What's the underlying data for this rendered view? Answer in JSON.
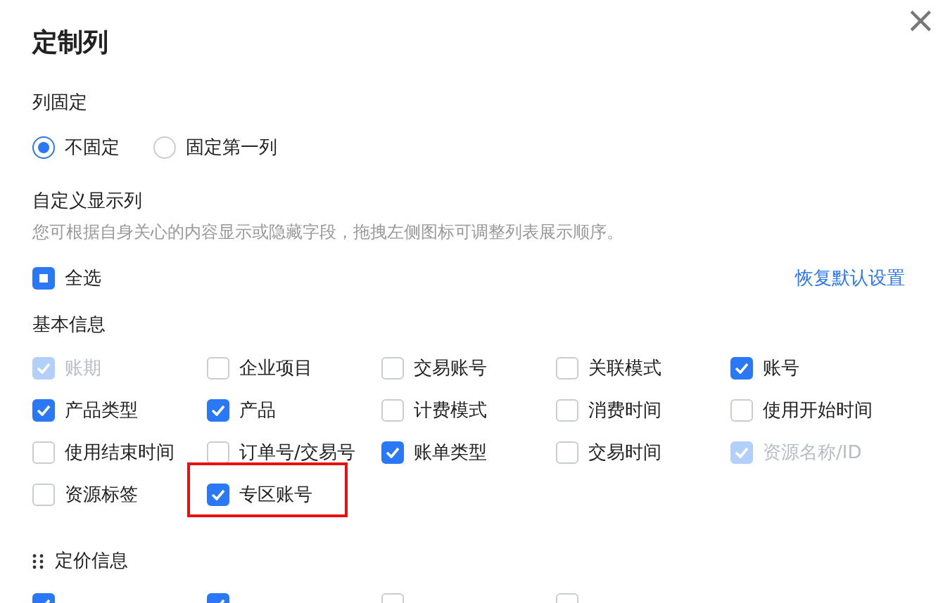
{
  "dialog": {
    "title": "定制列",
    "close": "×"
  },
  "fixed": {
    "label": "列固定",
    "options": [
      {
        "label": "不固定",
        "selected": true
      },
      {
        "label": "固定第一列",
        "selected": false
      }
    ]
  },
  "custom": {
    "label": "自定义显示列",
    "description": "您可根据自身关心的内容显示或隐藏字段，拖拽左侧图标可调整列表展示顺序。",
    "select_all": {
      "label": "全选",
      "indeterminate": true
    },
    "reset_link": "恢复默认设置"
  },
  "groups": [
    {
      "title": "基本信息",
      "items": [
        {
          "label": "账期",
          "checked": true,
          "disabled": true,
          "highlighted": false
        },
        {
          "label": "企业项目",
          "checked": false,
          "disabled": false,
          "highlighted": false
        },
        {
          "label": "交易账号",
          "checked": false,
          "disabled": false,
          "highlighted": false
        },
        {
          "label": "关联模式",
          "checked": false,
          "disabled": false,
          "highlighted": false
        },
        {
          "label": "账号",
          "checked": true,
          "disabled": false,
          "highlighted": false
        },
        {
          "label": "产品类型",
          "checked": true,
          "disabled": false,
          "highlighted": false
        },
        {
          "label": "产品",
          "checked": true,
          "disabled": false,
          "highlighted": false
        },
        {
          "label": "计费模式",
          "checked": false,
          "disabled": false,
          "highlighted": false
        },
        {
          "label": "消费时间",
          "checked": false,
          "disabled": false,
          "highlighted": false
        },
        {
          "label": "使用开始时间",
          "checked": false,
          "disabled": false,
          "highlighted": false
        },
        {
          "label": "使用结束时间",
          "checked": false,
          "disabled": false,
          "highlighted": false
        },
        {
          "label": "订单号/交易号",
          "checked": false,
          "disabled": false,
          "highlighted": false
        },
        {
          "label": "账单类型",
          "checked": true,
          "disabled": false,
          "highlighted": false
        },
        {
          "label": "交易时间",
          "checked": false,
          "disabled": false,
          "highlighted": false
        },
        {
          "label": "资源名称/ID",
          "checked": true,
          "disabled": true,
          "highlighted": false
        },
        {
          "label": "资源标签",
          "checked": false,
          "disabled": false,
          "highlighted": false
        },
        {
          "label": "专区账号",
          "checked": true,
          "disabled": false,
          "highlighted": true
        }
      ]
    },
    {
      "title": "定价信息",
      "draggable": true,
      "items": [
        {
          "checked": true,
          "disabled": false
        },
        {
          "checked": true,
          "disabled": false
        },
        {
          "checked": false,
          "disabled": false
        },
        {
          "checked": false,
          "disabled": false
        }
      ]
    }
  ]
}
